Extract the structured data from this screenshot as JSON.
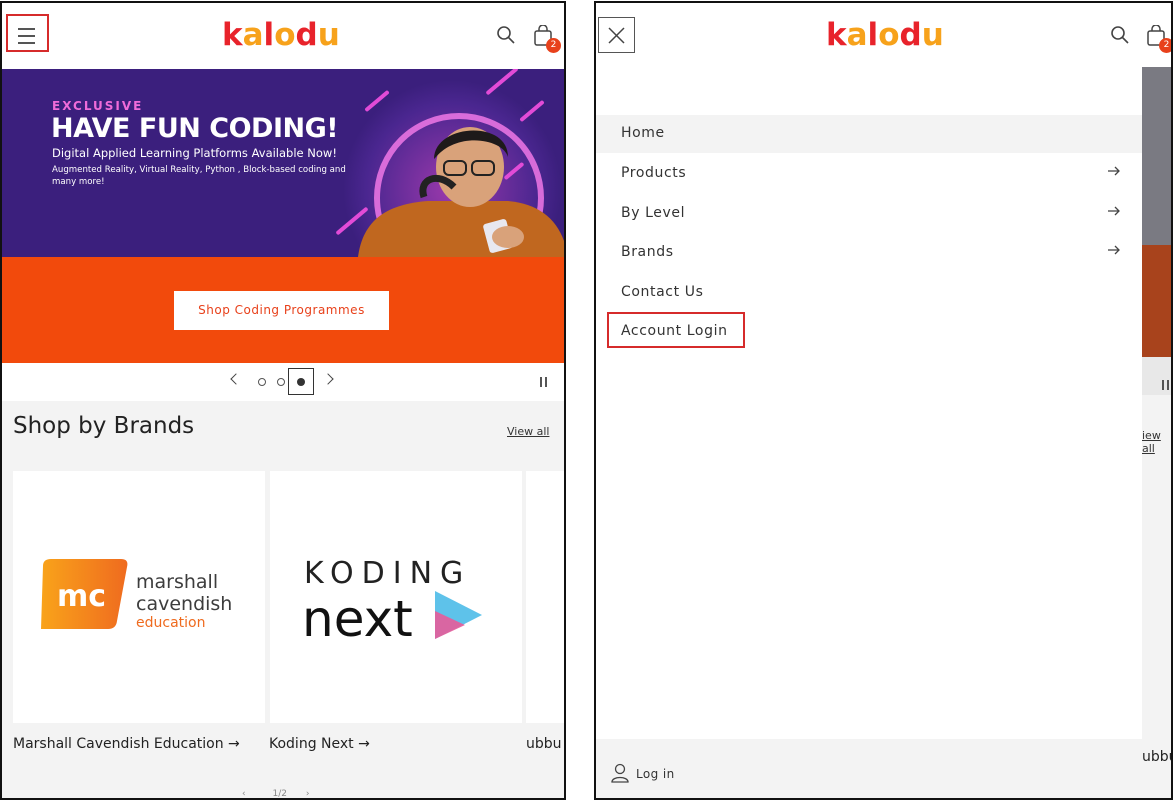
{
  "left_screen": {
    "header": {
      "logo": [
        "k",
        "a",
        "l",
        "o",
        "d",
        "u"
      ],
      "cart_count": "2"
    },
    "banner": {
      "eyebrow": "EXCLUSIVE",
      "headline": "HAVE FUN CODING!",
      "subheadline": "Digital Applied Learning Platforms Available Now!",
      "description": "Augmented Reality, Virtual Reality, Python , Block-based coding and many more!",
      "cta_label": "Shop Coding Programmes"
    },
    "slider": {
      "slides_total": 3,
      "active_slide": 3
    },
    "brands": {
      "title": "Shop by Brands",
      "view_all": "View all",
      "cards": [
        {
          "label": "Marshall Cavendish Education →",
          "logo_text": [
            "marshall",
            "cavendish",
            "education"
          ],
          "logo_mark": "mc"
        },
        {
          "label": "Koding Next →",
          "logo_text": [
            "KODING",
            "next"
          ]
        },
        {
          "label": "ubbu"
        }
      ],
      "pager": "1/2"
    }
  },
  "right_screen": {
    "header": {
      "logo": [
        "k",
        "a",
        "l",
        "o",
        "d",
        "u"
      ],
      "cart_count": "2"
    },
    "menu": [
      {
        "label": "Home",
        "has_arrow": false
      },
      {
        "label": "Products",
        "has_arrow": true
      },
      {
        "label": "By Level",
        "has_arrow": true
      },
      {
        "label": "Brands",
        "has_arrow": true
      },
      {
        "label": "Contact Us",
        "has_arrow": false
      },
      {
        "label": "Account Login",
        "has_arrow": false
      }
    ],
    "footer": {
      "login_label": "Log in"
    },
    "peek": {
      "view_all": "iew all",
      "brand": "ubbu"
    }
  },
  "colors": {
    "brand_red": "#e8232b",
    "brand_yellow": "#f7a21b",
    "banner_purple": "#3b1f7d",
    "banner_orange": "#f24a0c",
    "highlight_red": "#d62b2b",
    "badge": "#e8411b"
  }
}
